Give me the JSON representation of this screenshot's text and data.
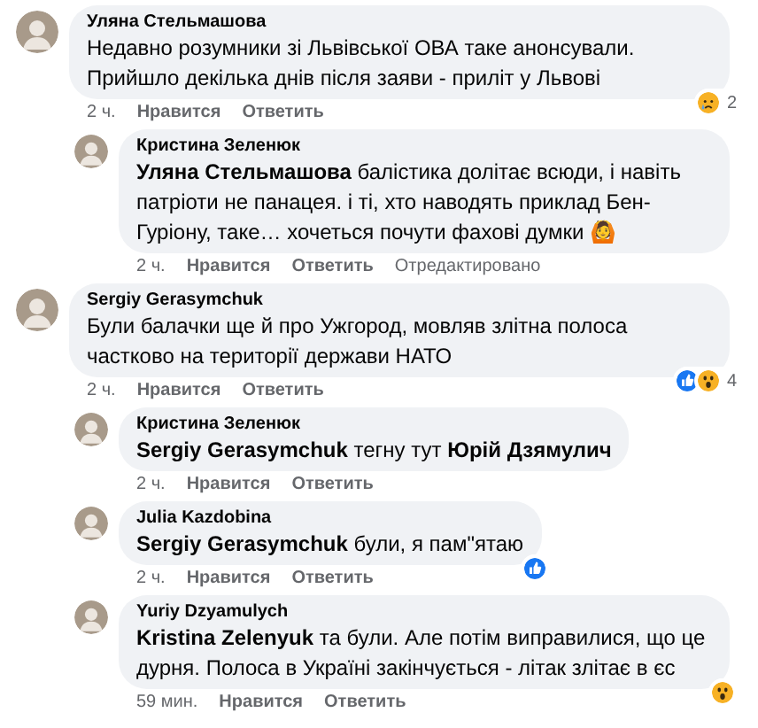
{
  "comments": [
    {
      "author": "Уляна Стельмашова",
      "text": "Недавно розумники зі Львівської ОВА таке анонсували. Прийшло декілька днів після заяви - приліт у Львові",
      "time": "2 ч.",
      "like": "Нравится",
      "reply": "Ответить",
      "reactions": [
        {
          "kind": "sad"
        }
      ],
      "reaction_count": "2",
      "replies": [
        {
          "author": "Кристина Зеленюк",
          "text": "**Уляна Стельмашова** балістика долітає всюди, і навіть патріоти не панацея. і ті, хто наводять приклад Бен-Гуріону, таке… хочеться почути фахові думки 🙆",
          "time": "2 ч.",
          "like": "Нравится",
          "reply": "Ответить",
          "edited_label": "Отредактировано"
        }
      ]
    },
    {
      "author": "Sergiy Gerasymchuk",
      "text": "Були балачки ще й про Ужгород, мовляв злітна полоса частково на території держави НАТО",
      "time": "2 ч.",
      "like": "Нравится",
      "reply": "Ответить",
      "reactions": [
        {
          "kind": "like"
        },
        {
          "kind": "wow"
        }
      ],
      "reaction_count": "4",
      "replies": [
        {
          "author": "Кристина Зеленюк",
          "text": "**Sergiy Gerasymchuk** тегну тут **Юрій Дзямулич**",
          "time": "2 ч.",
          "like": "Нравится",
          "reply": "Ответить"
        },
        {
          "author": "Julia Kazdobina",
          "text": "**Sergiy Gerasymchuk** були, я пам\"ятаю",
          "time": "2 ч.",
          "like": "Нравится",
          "reply": "Ответить",
          "reactions": [
            {
              "kind": "like"
            }
          ]
        },
        {
          "author": "Yuriy Dzyamulych",
          "text": "**Kristina Zelenyuk** та були. Але потім виправилися, що це дурня. Полоса в Україні закінчується - літак злітає в єс",
          "time": "59 мин.",
          "like": "Нравится",
          "reply": "Ответить",
          "reactions": [
            {
              "kind": "wow"
            }
          ]
        }
      ]
    }
  ]
}
